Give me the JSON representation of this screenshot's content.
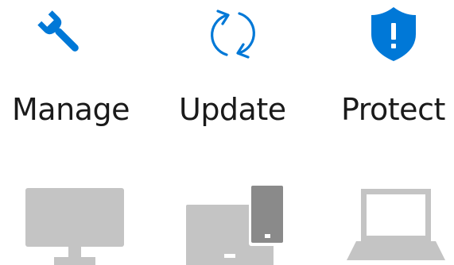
{
  "features": [
    {
      "label": "Manage",
      "icon": "wrench-icon"
    },
    {
      "label": "Update",
      "icon": "sync-arrows-icon"
    },
    {
      "label": "Protect",
      "icon": "shield-alert-icon"
    }
  ],
  "devices": [
    {
      "icon": "desktop-monitor-icon"
    },
    {
      "icon": "tablet-and-phone-icon"
    },
    {
      "icon": "laptop-icon"
    }
  ],
  "colors": {
    "accent": "#0078D7",
    "text": "#1a1a1a",
    "device_light": "#c4c4c4",
    "device_dark": "#8a8a8a"
  }
}
